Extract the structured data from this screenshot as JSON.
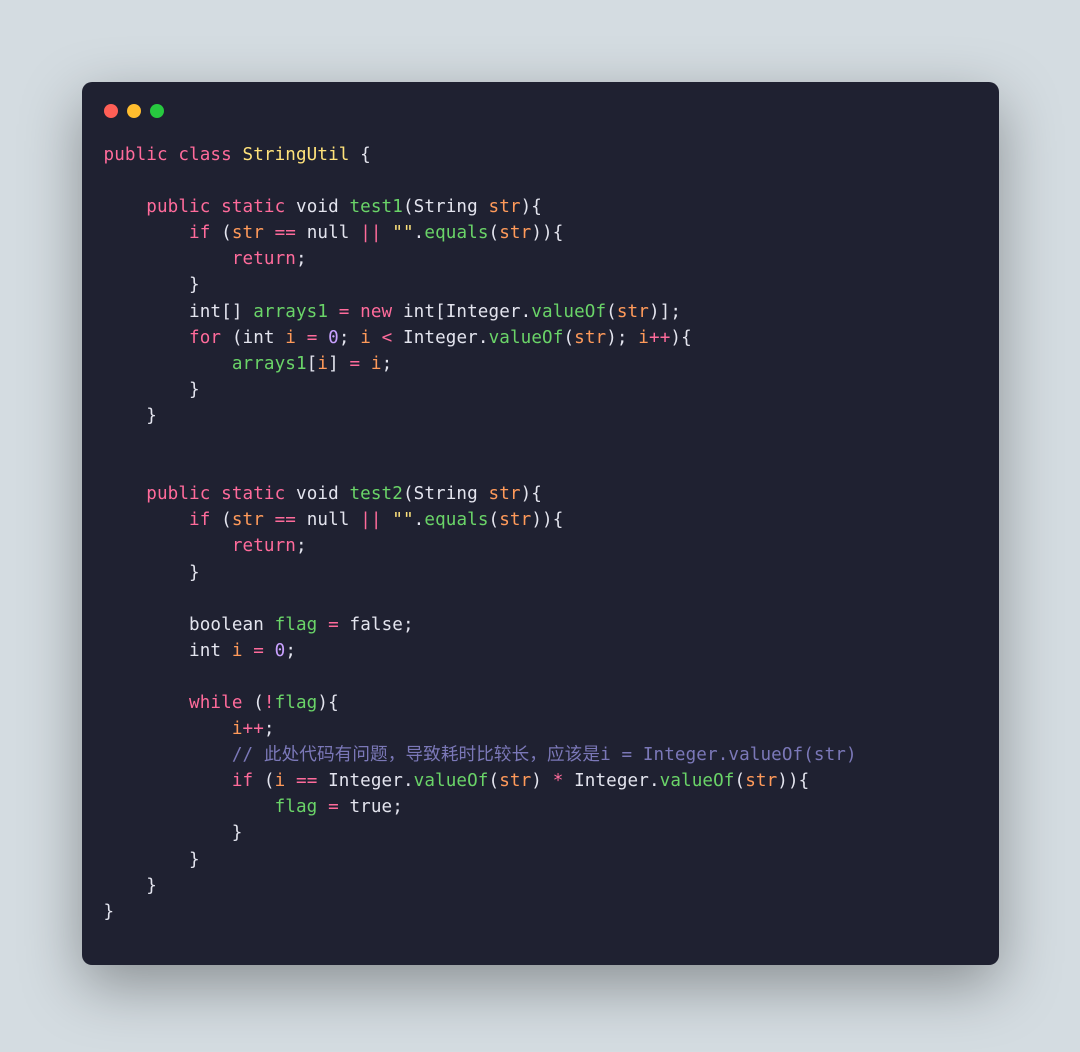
{
  "window": {
    "traffic": [
      "red",
      "yellow",
      "green"
    ]
  },
  "code": {
    "tokens": [
      [
        [
          "kw",
          "public"
        ],
        [
          "pn",
          " "
        ],
        [
          "kw",
          "class"
        ],
        [
          "pn",
          " "
        ],
        [
          "nm",
          "StringUtil"
        ],
        [
          "pn",
          " {"
        ]
      ],
      [],
      [
        [
          "pn",
          "    "
        ],
        [
          "kw",
          "public"
        ],
        [
          "pn",
          " "
        ],
        [
          "kw",
          "static"
        ],
        [
          "pn",
          " "
        ],
        [
          "type",
          "void"
        ],
        [
          "pn",
          " "
        ],
        [
          "fn",
          "test1"
        ],
        [
          "pn",
          "("
        ],
        [
          "type",
          "String"
        ],
        [
          "pn",
          " "
        ],
        [
          "var",
          "str"
        ],
        [
          "pn",
          "){"
        ]
      ],
      [
        [
          "pn",
          "        "
        ],
        [
          "kw",
          "if"
        ],
        [
          "pn",
          " ("
        ],
        [
          "var",
          "str"
        ],
        [
          "pn",
          " "
        ],
        [
          "op",
          "=="
        ],
        [
          "pn",
          " "
        ],
        [
          "type",
          "null"
        ],
        [
          "pn",
          " "
        ],
        [
          "op",
          "||"
        ],
        [
          "pn",
          " "
        ],
        [
          "str",
          "\"\""
        ],
        [
          "pn",
          "."
        ],
        [
          "fn",
          "equals"
        ],
        [
          "pn",
          "("
        ],
        [
          "var",
          "str"
        ],
        [
          "pn",
          ")){"
        ]
      ],
      [
        [
          "pn",
          "            "
        ],
        [
          "kw",
          "return"
        ],
        [
          "pn",
          ";"
        ]
      ],
      [
        [
          "pn",
          "        }"
        ]
      ],
      [
        [
          "pn",
          "        "
        ],
        [
          "type",
          "int"
        ],
        [
          "pn",
          "[] "
        ],
        [
          "fn",
          "arrays1"
        ],
        [
          "pn",
          " "
        ],
        [
          "op",
          "="
        ],
        [
          "pn",
          " "
        ],
        [
          "kw",
          "new"
        ],
        [
          "pn",
          " "
        ],
        [
          "type",
          "int"
        ],
        [
          "pn",
          "["
        ],
        [
          "type",
          "Integer"
        ],
        [
          "pn",
          "."
        ],
        [
          "fn",
          "valueOf"
        ],
        [
          "pn",
          "("
        ],
        [
          "var",
          "str"
        ],
        [
          "pn",
          ")];"
        ]
      ],
      [
        [
          "pn",
          "        "
        ],
        [
          "kw",
          "for"
        ],
        [
          "pn",
          " ("
        ],
        [
          "type",
          "int"
        ],
        [
          "pn",
          " "
        ],
        [
          "var",
          "i"
        ],
        [
          "pn",
          " "
        ],
        [
          "op",
          "="
        ],
        [
          "pn",
          " "
        ],
        [
          "num",
          "0"
        ],
        [
          "pn",
          "; "
        ],
        [
          "var",
          "i"
        ],
        [
          "pn",
          " "
        ],
        [
          "op",
          "<"
        ],
        [
          "pn",
          " "
        ],
        [
          "type",
          "Integer"
        ],
        [
          "pn",
          "."
        ],
        [
          "fn",
          "valueOf"
        ],
        [
          "pn",
          "("
        ],
        [
          "var",
          "str"
        ],
        [
          "pn",
          "); "
        ],
        [
          "var",
          "i"
        ],
        [
          "op",
          "++"
        ],
        [
          "pn",
          "){"
        ]
      ],
      [
        [
          "pn",
          "            "
        ],
        [
          "fn",
          "arrays1"
        ],
        [
          "pn",
          "["
        ],
        [
          "var",
          "i"
        ],
        [
          "pn",
          "] "
        ],
        [
          "op",
          "="
        ],
        [
          "pn",
          " "
        ],
        [
          "var",
          "i"
        ],
        [
          "pn",
          ";"
        ]
      ],
      [
        [
          "pn",
          "        }"
        ]
      ],
      [
        [
          "pn",
          "    }"
        ]
      ],
      [],
      [],
      [
        [
          "pn",
          "    "
        ],
        [
          "kw",
          "public"
        ],
        [
          "pn",
          " "
        ],
        [
          "kw",
          "static"
        ],
        [
          "pn",
          " "
        ],
        [
          "type",
          "void"
        ],
        [
          "pn",
          " "
        ],
        [
          "fn",
          "test2"
        ],
        [
          "pn",
          "("
        ],
        [
          "type",
          "String"
        ],
        [
          "pn",
          " "
        ],
        [
          "var",
          "str"
        ],
        [
          "pn",
          "){"
        ]
      ],
      [
        [
          "pn",
          "        "
        ],
        [
          "kw",
          "if"
        ],
        [
          "pn",
          " ("
        ],
        [
          "var",
          "str"
        ],
        [
          "pn",
          " "
        ],
        [
          "op",
          "=="
        ],
        [
          "pn",
          " "
        ],
        [
          "type",
          "null"
        ],
        [
          "pn",
          " "
        ],
        [
          "op",
          "||"
        ],
        [
          "pn",
          " "
        ],
        [
          "str",
          "\"\""
        ],
        [
          "pn",
          "."
        ],
        [
          "fn",
          "equals"
        ],
        [
          "pn",
          "("
        ],
        [
          "var",
          "str"
        ],
        [
          "pn",
          ")){"
        ]
      ],
      [
        [
          "pn",
          "            "
        ],
        [
          "kw",
          "return"
        ],
        [
          "pn",
          ";"
        ]
      ],
      [
        [
          "pn",
          "        }"
        ]
      ],
      [],
      [
        [
          "pn",
          "        "
        ],
        [
          "type",
          "boolean"
        ],
        [
          "pn",
          " "
        ],
        [
          "fn",
          "flag"
        ],
        [
          "pn",
          " "
        ],
        [
          "op",
          "="
        ],
        [
          "pn",
          " "
        ],
        [
          "type",
          "false"
        ],
        [
          "pn",
          ";"
        ]
      ],
      [
        [
          "pn",
          "        "
        ],
        [
          "type",
          "int"
        ],
        [
          "pn",
          " "
        ],
        [
          "var",
          "i"
        ],
        [
          "pn",
          " "
        ],
        [
          "op",
          "="
        ],
        [
          "pn",
          " "
        ],
        [
          "num",
          "0"
        ],
        [
          "pn",
          ";"
        ]
      ],
      [],
      [
        [
          "pn",
          "        "
        ],
        [
          "kw",
          "while"
        ],
        [
          "pn",
          " ("
        ],
        [
          "op",
          "!"
        ],
        [
          "fn",
          "flag"
        ],
        [
          "pn",
          "){"
        ]
      ],
      [
        [
          "pn",
          "            "
        ],
        [
          "var",
          "i"
        ],
        [
          "op",
          "++"
        ],
        [
          "pn",
          ";"
        ]
      ],
      [
        [
          "pn",
          "            "
        ],
        [
          "cmt",
          "// 此处代码有问题，导致耗时比较长，应该是i = Integer.valueOf(str)"
        ]
      ],
      [
        [
          "pn",
          "            "
        ],
        [
          "kw",
          "if"
        ],
        [
          "pn",
          " ("
        ],
        [
          "var",
          "i"
        ],
        [
          "pn",
          " "
        ],
        [
          "op",
          "=="
        ],
        [
          "pn",
          " "
        ],
        [
          "type",
          "Integer"
        ],
        [
          "pn",
          "."
        ],
        [
          "fn",
          "valueOf"
        ],
        [
          "pn",
          "("
        ],
        [
          "var",
          "str"
        ],
        [
          "pn",
          ") "
        ],
        [
          "op",
          "*"
        ],
        [
          "pn",
          " "
        ],
        [
          "type",
          "Integer"
        ],
        [
          "pn",
          "."
        ],
        [
          "fn",
          "valueOf"
        ],
        [
          "pn",
          "("
        ],
        [
          "var",
          "str"
        ],
        [
          "pn",
          ")){"
        ]
      ],
      [
        [
          "pn",
          "                "
        ],
        [
          "fn",
          "flag"
        ],
        [
          "pn",
          " "
        ],
        [
          "op",
          "="
        ],
        [
          "pn",
          " "
        ],
        [
          "type",
          "true"
        ],
        [
          "pn",
          ";"
        ]
      ],
      [
        [
          "pn",
          "            }"
        ]
      ],
      [
        [
          "pn",
          "        }"
        ]
      ],
      [
        [
          "pn",
          "    }"
        ]
      ],
      [
        [
          "pn",
          "}"
        ]
      ]
    ]
  }
}
